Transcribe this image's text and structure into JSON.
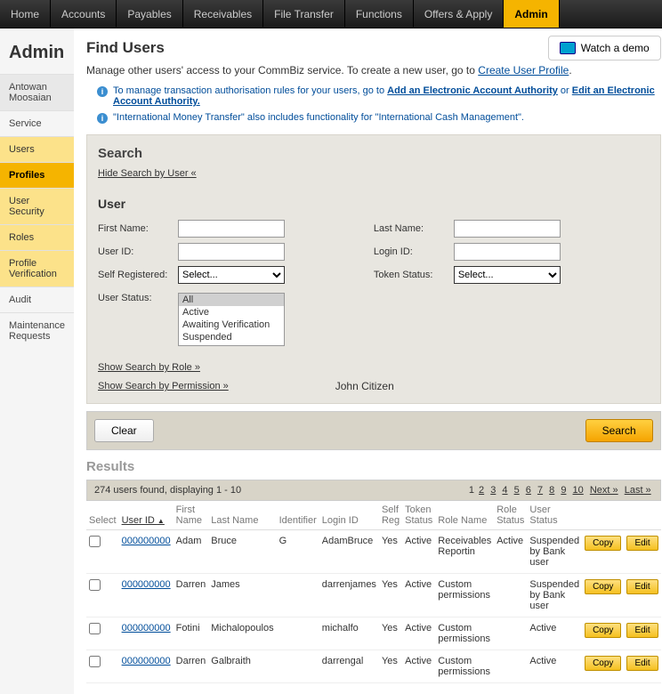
{
  "topnav": [
    "Home",
    "Accounts",
    "Payables",
    "Receivables",
    "File Transfer",
    "Functions",
    "Offers & Apply",
    "Admin"
  ],
  "topnav_active": 7,
  "sidebar": {
    "title": "Admin",
    "items": [
      "Antowan Moosaian",
      "Service",
      "Users",
      "Profiles",
      "User Security",
      "Roles",
      "Profile Verification",
      "Audit",
      "Maintenance Requests"
    ]
  },
  "page": {
    "title": "Find Users",
    "demo_label": "Watch a demo",
    "intro_pre": "Manage other users' access to your CommBiz service. To create a new user, go to ",
    "intro_link": "Create User Profile",
    "info1_pre": "To manage transaction authorisation rules for your users, go to ",
    "info1_link1": "Add an Electronic Account Authority",
    "info1_mid": " or ",
    "info1_link2": "Edit an Electronic Account Authority.",
    "info2": "\"International Money Transfer\" also includes functionality for \"International Cash Management\"."
  },
  "search": {
    "title": "Search",
    "hide": "Hide Search by User «",
    "user_heading": "User",
    "labels": {
      "first_name": "First Name:",
      "last_name": "Last Name:",
      "user_id": "User ID:",
      "login_id": "Login ID:",
      "self_reg": "Self Registered:",
      "token_status": "Token Status:",
      "user_status": "User Status:"
    },
    "select_placeholder": "Select...",
    "status_options": [
      "All",
      "Active",
      "Awaiting Verification",
      "Suspended"
    ],
    "show_role": "Show Search by Role »",
    "show_perm": "Show Search by Permission »",
    "citizen": "John Citizen",
    "clear": "Clear",
    "search_btn": "Search"
  },
  "results": {
    "title": "Results",
    "summary": "274 users found, displaying 1 - 10",
    "pages": [
      "1",
      "2",
      "3",
      "4",
      "5",
      "6",
      "7",
      "8",
      "9",
      "10"
    ],
    "next": "Next »",
    "last": "Last »",
    "headers": [
      "Select",
      "User ID",
      "First Name",
      "Last Name",
      "Identifier",
      "Login ID",
      "Self Reg",
      "Token Status",
      "Role Name",
      "Role Status",
      "User Status",
      "",
      ""
    ],
    "rows": [
      {
        "uid": "000000000",
        "fn": "Adam",
        "ln": "Bruce",
        "ident": "G",
        "login": "AdamBruce",
        "sr": "Yes",
        "ts": "Active",
        "rn": "Receivables Reportin",
        "rs": "Active",
        "us": "Suspended by Bank user"
      },
      {
        "uid": "000000000",
        "fn": "Darren",
        "ln": "James",
        "ident": "",
        "login": "darrenjames",
        "sr": "Yes",
        "ts": "Active",
        "rn": "Custom permissions",
        "rs": "",
        "us": "Suspended by Bank user"
      },
      {
        "uid": "000000000",
        "fn": "Fotini",
        "ln": "Michalopoulos",
        "ident": "",
        "login": "michalfo",
        "sr": "Yes",
        "ts": "Active",
        "rn": "Custom permissions",
        "rs": "",
        "us": "Active"
      },
      {
        "uid": "000000000",
        "fn": "Darren",
        "ln": "Galbraith",
        "ident": "",
        "login": "darrengal",
        "sr": "Yes",
        "ts": "Active",
        "rn": "Custom permissions",
        "rs": "",
        "us": "Active"
      }
    ],
    "copy": "Copy",
    "edit": "Edit"
  }
}
